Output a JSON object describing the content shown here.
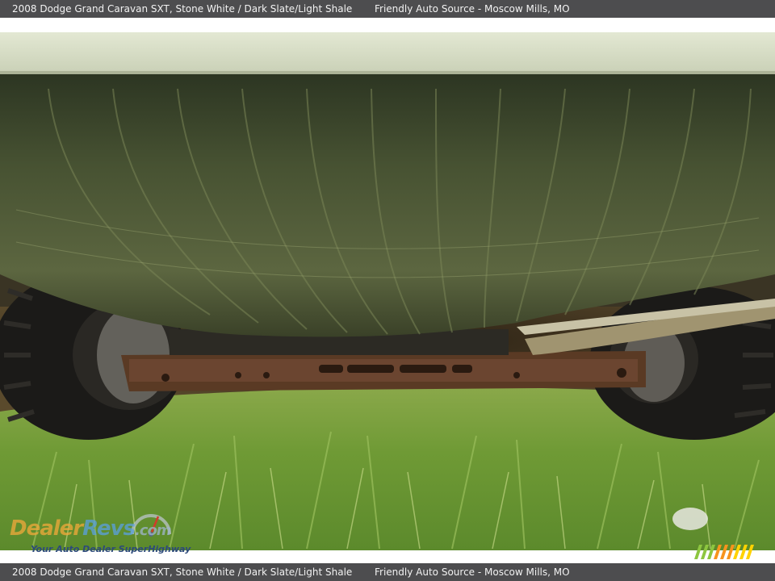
{
  "header": {
    "vehicle": "2008 Dodge Grand Caravan SXT,  Stone White / Dark Slate/Light Shale",
    "dealer": "Friendly Auto Source - Moscow Mills, MO"
  },
  "footer": {
    "vehicle": "2008 Dodge Grand Caravan SXT,  Stone White / Dark Slate/Light Shale",
    "dealer": "Friendly Auto Source - Moscow Mills, MO"
  },
  "watermark": {
    "brand_part1": "Dealer",
    "brand_part2": "Revs",
    "brand_part3": ".com",
    "tagline": "Your Auto Dealer SuperHighway"
  },
  "logo_mark": {
    "icon": "striped-mm-logo",
    "colors": [
      "#8dc63f",
      "#f7941d",
      "#ffd200"
    ]
  },
  "colors": {
    "bar_background": "#4d4d4f",
    "bar_text": "#f2f2f2"
  }
}
